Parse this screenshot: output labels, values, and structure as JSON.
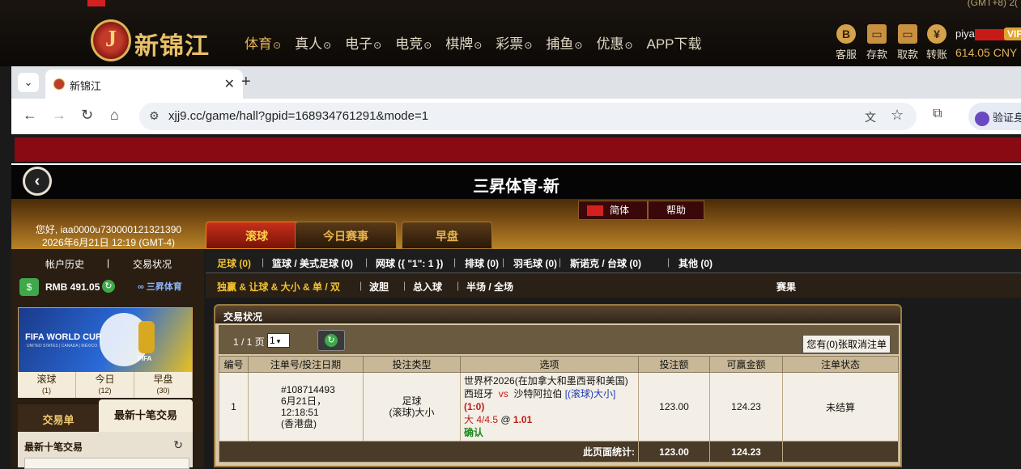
{
  "site": {
    "gmt_top": "(GMT+8) 2(",
    "logo_letter": "J",
    "logo_text": "新锦江",
    "nav": [
      {
        "label": "体育",
        "active": true
      },
      {
        "label": "真人"
      },
      {
        "label": "电子"
      },
      {
        "label": "电竞"
      },
      {
        "label": "棋牌"
      },
      {
        "label": "彩票"
      },
      {
        "label": "捕鱼"
      },
      {
        "label": "优惠"
      },
      {
        "label": "APP下载",
        "nochev": true
      }
    ],
    "header_icons": [
      {
        "label": "客服",
        "icon": "chat-icon"
      },
      {
        "label": "存款",
        "icon": "wallet-icon"
      },
      {
        "label": "取款",
        "icon": "cash-icon"
      },
      {
        "label": "转账",
        "icon": "transfer-icon"
      }
    ],
    "username_prefix": "piya",
    "vip": "VIP",
    "balance": "614.05 CNY"
  },
  "browser": {
    "tab_title": "新锦江",
    "url": "xjj9.cc/game/hall?gpid=168934761291&mode=1",
    "verify_label": "验证身"
  },
  "game": {
    "title": "三昇体育-新",
    "lang": "简体",
    "help": "帮助",
    "greeting_line1": "您好, iaa0000u730000121321390",
    "greeting_line2": "2026年6月21日 12:19 (GMT-4)",
    "main_tabs": [
      "滚球",
      "今日赛事",
      "早盘"
    ],
    "sidebar": {
      "account_history": "帐户历史",
      "separator": "|",
      "trade_status": "交易状况",
      "rmb": "RMB 491.05",
      "brand": "三昇体育",
      "fifa_text": "FIFA WORLD CUP",
      "fifa_sub": "UNITED STATES | CANADA | MÉXICO",
      "fifa_logo": "FIFA",
      "categories": [
        {
          "label": "滚球",
          "count": "(1)"
        },
        {
          "label": "今日",
          "count": "(12)"
        },
        {
          "label": "早盘",
          "count": "(30)"
        }
      ],
      "tab_slip": "交易单",
      "tab_last10": "最新十笔交易",
      "last10_title": "最新十笔交易"
    },
    "sports": [
      {
        "label": "足球 (0)",
        "active": true
      },
      {
        "label": "篮球 / 美式足球 (0)"
      },
      {
        "label": "网球 ({ \"1\": 1 })"
      },
      {
        "label": "排球 (0)"
      },
      {
        "label": "羽毛球 (0)"
      },
      {
        "label": "斯诺克 / 台球 (0)"
      },
      {
        "label": "其他 (0)"
      }
    ],
    "bet_types": [
      {
        "label": "独赢 & 让球 & 大小 & 单 / 双",
        "active": true
      },
      {
        "label": "波胆"
      },
      {
        "label": "总入球"
      },
      {
        "label": "半场 / 全场"
      }
    ],
    "results_link": "赛果",
    "status_panel": {
      "header": "交易状况",
      "pager": "1 / 1 页",
      "page_value": "1",
      "cancel_btn": "您有(0)张取消注单",
      "columns": [
        "编号",
        "注单号/投注日期",
        "投注类型",
        "选项",
        "投注额",
        "可赢金额",
        "注单状态"
      ],
      "row": {
        "no": "1",
        "ticket": "#108714493",
        "date": "6月21日，12:18:51",
        "market": "(香港盘)",
        "type_line1": "足球",
        "type_line2": "(滚球)大小",
        "league": "世界杯2026(在加拿大和墨西哥和美国)",
        "home": "西班牙",
        "vs": "vs",
        "away": "沙特阿拉伯",
        "bet_kind": "[(滚球)大小]",
        "score": "(1:0)",
        "pick": "大 4/4.5",
        "at": "@",
        "odds": "1.01",
        "confirm": "确认",
        "stake": "123.00",
        "win": "124.23",
        "status": "未结算"
      },
      "sum_label": "此页面统计:",
      "sum_stake": "123.00",
      "sum_win": "124.23"
    }
  }
}
